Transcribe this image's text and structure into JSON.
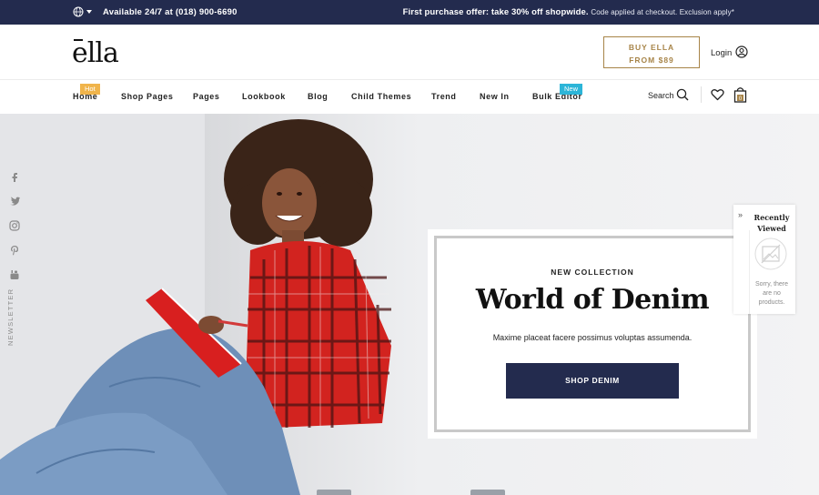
{
  "topbar": {
    "availability": "Available 24/7 at (018) 900-6690",
    "offer_bold": "First purchase offer: take 30% off shopwide.",
    "offer_fine": "Code applied at checkout. Exclusion apply*"
  },
  "header": {
    "logo": "ella",
    "buy_line1": "BUY ELLA",
    "buy_line2": "FROM $89",
    "login_label": "Login"
  },
  "nav": {
    "items": [
      {
        "label": "Home",
        "badge": "Hot"
      },
      {
        "label": "Shop Pages"
      },
      {
        "label": "Pages"
      },
      {
        "label": "Lookbook"
      },
      {
        "label": "Blog"
      },
      {
        "label": "Child Themes"
      },
      {
        "label": "Trend"
      },
      {
        "label": "New In"
      },
      {
        "label": "Bulk Editor",
        "badge": "New"
      }
    ],
    "search_label": "Search",
    "cart_count": "0"
  },
  "social": {
    "icons": [
      "facebook-icon",
      "twitter-icon",
      "instagram-icon",
      "pinterest-icon",
      "youtube-icon"
    ],
    "newsletter_label": "NEWSLETTER"
  },
  "hero": {
    "eyebrow": "NEW COLLECTION",
    "title": "World of Denim",
    "subtitle": "Maxime placeat facere possimus voluptas assumenda.",
    "cta_label": "SHOP DENIM"
  },
  "recently_viewed": {
    "title": "Recently Viewed",
    "empty_text": "Sorry, there are no products."
  },
  "colors": {
    "navy": "#232b4e",
    "gold": "#a78448",
    "hot_badge": "#f0b44b",
    "new_badge": "#2cb5d8",
    "shirt_red": "#d2231f",
    "denim": "#6e8fb8"
  }
}
